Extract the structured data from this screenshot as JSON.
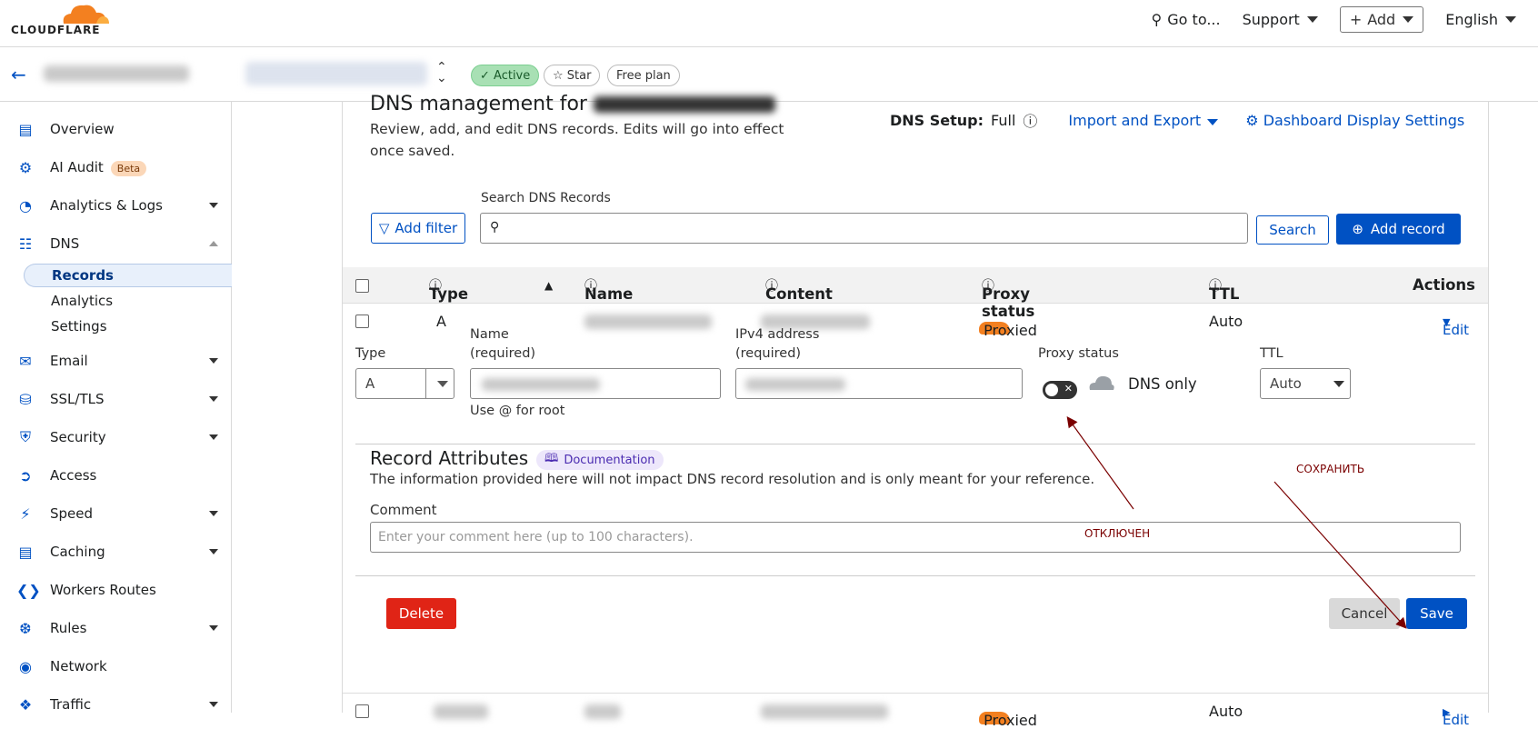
{
  "header": {
    "brand": "CLOUDFLARE",
    "goto": "Go to...",
    "support": "Support",
    "add": "Add",
    "language": "English"
  },
  "zone": {
    "active": "Active",
    "star": "Star",
    "plan": "Free plan"
  },
  "sidebar": {
    "overview": "Overview",
    "ai_audit": "AI Audit",
    "beta": "Beta",
    "analytics_logs": "Analytics & Logs",
    "dns": "DNS",
    "records": "Records",
    "analytics": "Analytics",
    "settings": "Settings",
    "email": "Email",
    "ssl": "SSL/TLS",
    "security": "Security",
    "access": "Access",
    "speed": "Speed",
    "caching": "Caching",
    "workers_routes": "Workers Routes",
    "rules": "Rules",
    "network": "Network",
    "traffic": "Traffic"
  },
  "main": {
    "title": "DNS management for",
    "description": "Review, add, and edit DNS records. Edits will go into effect once saved.",
    "dns_setup_label": "DNS Setup:",
    "dns_setup_value": "Full",
    "import_export": "Import and Export",
    "display_settings": "Dashboard Display Settings",
    "search_label": "Search DNS Records",
    "add_filter": "Add filter",
    "search_button": "Search",
    "add_record": "Add record"
  },
  "table": {
    "headers": {
      "type": "Type",
      "name": "Name",
      "content": "Content",
      "proxy": "Proxy status",
      "ttl": "TTL",
      "actions": "Actions"
    },
    "row1": {
      "type": "A",
      "proxy": "Proxied",
      "ttl": "Auto",
      "action": "Edit"
    },
    "row2": {
      "proxy": "Proxied",
      "ttl": "Auto",
      "action": "Edit"
    }
  },
  "edit": {
    "type_label": "Type",
    "type_value": "A",
    "name_label": "Name",
    "name_req": "(required)",
    "name_hint": "Use @ for root",
    "ipv4_label": "IPv4 address",
    "ipv4_req": "(required)",
    "proxy_label": "Proxy status",
    "proxy_value": "DNS only",
    "ttl_label": "TTL",
    "ttl_value": "Auto",
    "attributes_title": "Record Attributes",
    "documentation": "Documentation",
    "info": "The information provided here will not impact DNS record resolution and is only meant for your reference.",
    "comment_label": "Comment",
    "comment_placeholder": "Enter your comment here (up to 100 characters).",
    "delete": "Delete",
    "cancel": "Cancel",
    "save": "Save"
  },
  "annotations": {
    "disabled": "ОТКЛЮЧЕН",
    "save": "СОХРАНИТЬ"
  },
  "colors": {
    "accent": "#0051c3",
    "cloud_orange": "#f38020",
    "danger": "#e02416",
    "annotation": "#7a0000"
  }
}
